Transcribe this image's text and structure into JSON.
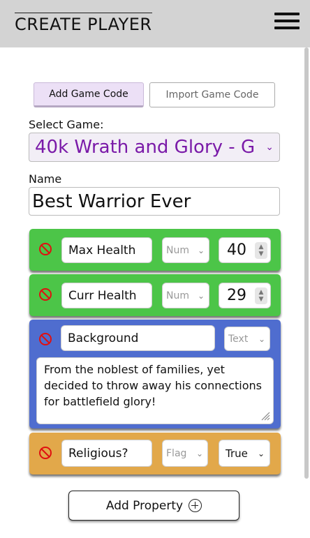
{
  "header": {
    "title": "CREATE PLAYER",
    "menu_icon": "hamburger-menu-icon"
  },
  "code_buttons": {
    "add": "Add Game Code",
    "import": "Import Game Code"
  },
  "game_select": {
    "label": "Select Game:",
    "value": "40k Wrath and Glory - G"
  },
  "name_field": {
    "label": "Name",
    "value": "Best Warrior Ever"
  },
  "properties": [
    {
      "name": "Max Health",
      "type": "Num",
      "value": "40",
      "color": "#4cc548"
    },
    {
      "name": "Curr Health",
      "type": "Num",
      "value": "29",
      "color": "#4cc548"
    },
    {
      "name": "Background",
      "type": "Text",
      "value": "From the noblest of families, yet decided to throw away his connections for battlefield glory!",
      "color": "#4f6dcf"
    },
    {
      "name": "Religious?",
      "type": "Flag",
      "value": "True",
      "color": "#e2a84a"
    }
  ],
  "add_property_button": "Add Property"
}
